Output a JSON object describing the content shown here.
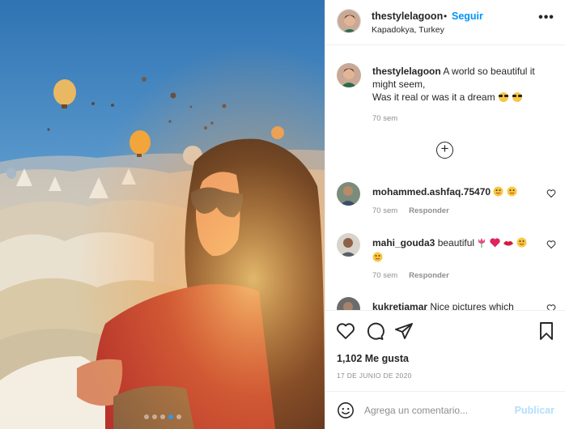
{
  "post": {
    "username": "thestylelagoon",
    "separator": "•",
    "follow_label": "Seguir",
    "location": "Kapadokya, Turkey",
    "more_label": "•••"
  },
  "caption": {
    "username": "thestylelagoon",
    "line1": "A world so beautiful it might seem,",
    "line2": "Was it real or was it a dream",
    "time": "70 sem"
  },
  "load_more_label": "+",
  "comments": [
    {
      "username": "mohammed.ashfaq.75470",
      "text": "",
      "emojis": [
        "face",
        "face"
      ],
      "time": "70 sem",
      "reply": "Responder"
    },
    {
      "username": "mahi_gouda3",
      "text": "beautiful",
      "emojis": [
        "tulip",
        "heart",
        "lips",
        "face",
        "face"
      ],
      "time": "70 sem",
      "reply": "Responder"
    },
    {
      "username": "kukretiamar",
      "text": "Nice pictures which"
    }
  ],
  "likes_text": "1,102 Me gusta",
  "date_text": "17 DE JUNIO DE 2020",
  "compose": {
    "placeholder": "Agrega un comentario...",
    "publish_label": "Publicar"
  },
  "carousel": {
    "count": 5,
    "active": 4
  },
  "colors": {
    "accent": "#0095f6",
    "publish_disabled": "#b2dffc",
    "muted": "#8e8e8e"
  }
}
